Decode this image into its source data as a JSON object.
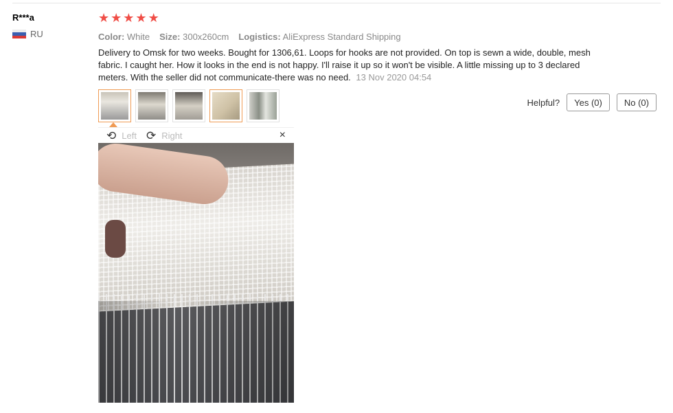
{
  "review": {
    "user": {
      "name": "R***a",
      "country": "RU"
    },
    "rating": {
      "stars": 5,
      "max": 5,
      "color": "#f04d46",
      "symbol": "★"
    },
    "attributes": {
      "color_label": "Color:",
      "color_value": "White",
      "size_label": "Size:",
      "size_value": "300x260cm",
      "logistics_label": "Logistics:",
      "logistics_value": "AliExpress Standard Shipping"
    },
    "text": "Delivery to Omsk for two weeks. Bought for 1306,61. Loops for hooks are not provided. On top is sewn a wide, double, mesh fabric. I caught her. How it looks in the end is not happy. I'll raise it up so it won't be visible. A little missing up to 3 declared meters. With the seller did not communicate-there was no need.",
    "date": "13 Nov 2020 04:54",
    "thumbnails_count": 5,
    "active_thumbnail": 1,
    "viewer": {
      "rotate_left_label": "Left",
      "rotate_right_label": "Right",
      "close_symbol": "×"
    },
    "helpful": {
      "label": "Helpful?",
      "yes_label": "Yes (0)",
      "no_label": "No (0)"
    }
  },
  "colors": {
    "accent_border": "#f09a53",
    "star": "#f04d46"
  }
}
